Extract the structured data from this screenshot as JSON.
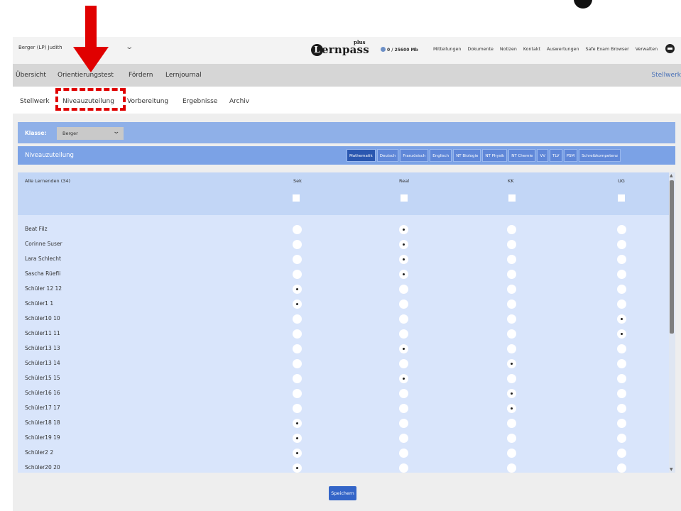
{
  "header": {
    "user": "Berger (LP) Judith",
    "logo_letter": "L",
    "logo_word": "ernpass",
    "logo_plus": "plus",
    "storage": "0 / 25600 Mb",
    "nav": [
      "Mitteilungen",
      "Dokumente",
      "Notizen",
      "Kontakt",
      "Auswertungen",
      "Safe Exam Browser",
      "Verwalten"
    ]
  },
  "mainnav": {
    "items": [
      "Übersicht",
      "Orientierungstest",
      "Fördern",
      "Lernjournal"
    ],
    "right": "Stellwerk"
  },
  "subnav": {
    "items": [
      "Stellwerk",
      "Niveauzuteilung",
      "Vorbereitung",
      "Ergebnisse",
      "Archiv"
    ],
    "active": "Niveauzuteilung"
  },
  "klasse": {
    "label": "Klasse:",
    "value": "Berger"
  },
  "niveau": {
    "title": "Niveauzuteilung",
    "subjects": [
      "Mathematik",
      "Deutsch",
      "Französisch",
      "Englisch",
      "NT Biologie",
      "NT Physik",
      "NT Chemie",
      "VV",
      "TLV",
      "PSM",
      "Schreibkompetenz"
    ],
    "active_subject": "Mathematik"
  },
  "table": {
    "all_label": "Alle Lernenden (34)",
    "columns": [
      "Sek",
      "Real",
      "KK",
      "UG"
    ],
    "rows": [
      {
        "name": "Beat Filz",
        "level": "Real"
      },
      {
        "name": "Corinne Suser",
        "level": "Real"
      },
      {
        "name": "Lara Schlecht",
        "level": "Real"
      },
      {
        "name": "Sascha Rüefli",
        "level": "Real"
      },
      {
        "name": "Schüler 12 12",
        "level": "Sek"
      },
      {
        "name": "Schüler1 1",
        "level": "Sek"
      },
      {
        "name": "Schüler10 10",
        "level": "UG"
      },
      {
        "name": "Schüler11 11",
        "level": "UG"
      },
      {
        "name": "Schüler13 13",
        "level": "Real"
      },
      {
        "name": "Schüler13 14",
        "level": "KK"
      },
      {
        "name": "Schüler15 15",
        "level": "Real"
      },
      {
        "name": "Schüler16 16",
        "level": "KK"
      },
      {
        "name": "Schüler17 17",
        "level": "KK"
      },
      {
        "name": "Schüler18 18",
        "level": "Sek"
      },
      {
        "name": "Schüler19 19",
        "level": "Sek"
      },
      {
        "name": "Schüler2 2",
        "level": "Sek"
      },
      {
        "name": "Schüler20 20",
        "level": "Sek"
      }
    ]
  },
  "save_label": "Speichern",
  "colors": {
    "accent_bar": "#8fb0e8",
    "active_subject": "#2a57b0",
    "annotation": "#e00000"
  }
}
